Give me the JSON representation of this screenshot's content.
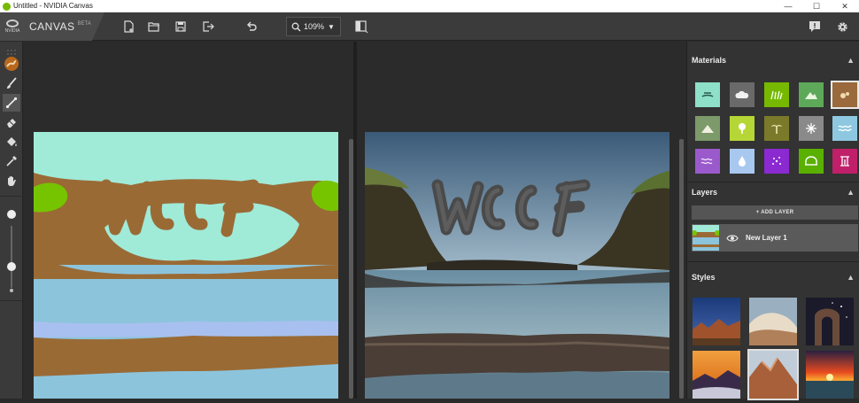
{
  "window": {
    "title": "Untitled - NVIDIA Canvas"
  },
  "brand": {
    "logo_text": "NVIDIA",
    "name": "CANVAS",
    "beta": "BETA"
  },
  "toolbar": {
    "zoom_value": "109%",
    "buttons": [
      "new-file",
      "open-folder",
      "save",
      "export",
      "undo",
      "zoom",
      "toggle-view",
      "feedback",
      "settings"
    ]
  },
  "left_tools": [
    "material-picker",
    "brush",
    "line",
    "eraser",
    "fill-bucket",
    "eyedropper",
    "pan-hand"
  ],
  "panels": {
    "materials": {
      "title": "Materials",
      "items": [
        {
          "name": "beach",
          "color": "#8ee0c8"
        },
        {
          "name": "cloud",
          "color": "#6a6a6a"
        },
        {
          "name": "grass",
          "color": "#76b900"
        },
        {
          "name": "hill",
          "color": "#5ea85a"
        },
        {
          "name": "dirt",
          "color": "#9a6a3c"
        },
        {
          "name": "mountain",
          "color": "#7d9a6a"
        },
        {
          "name": "tree",
          "color": "#b6d636"
        },
        {
          "name": "palm",
          "color": "#7a7a2a"
        },
        {
          "name": "snow",
          "color": "#8a8a8a"
        },
        {
          "name": "water",
          "color": "#8ec8e0"
        },
        {
          "name": "river",
          "color": "#9a5acb"
        },
        {
          "name": "waterdrop",
          "color": "#a8c8f0"
        },
        {
          "name": "sparkle",
          "color": "#8a2ad0"
        },
        {
          "name": "sea",
          "color": "#5ab000"
        },
        {
          "name": "waterfall",
          "color": "#c0206a"
        }
      ]
    },
    "layers": {
      "title": "Layers",
      "add_label": "+ ADD LAYER",
      "items": [
        {
          "name": "New Layer 1"
        }
      ]
    },
    "styles": {
      "title": "Styles"
    }
  },
  "colors": {
    "accent_orange": "#b8681c",
    "sky_mint": "#a0ead8",
    "dirt_brown": "#9a6a35",
    "water_blue": "#8cc4dc",
    "grass_green": "#76c400"
  }
}
